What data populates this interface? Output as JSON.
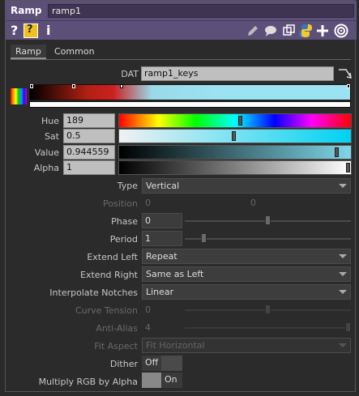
{
  "colors": {
    "titlebar": "#5c4f78",
    "accent": "#6a5a8e"
  },
  "titlebar": {
    "op_type": "Ramp",
    "op_name": "ramp1"
  },
  "iconbar": {
    "left_icons": [
      "help-icon",
      "python-help-icon",
      "info-icon"
    ],
    "right_icons": [
      "pencil-icon",
      "comment-icon",
      "clone-icon",
      "python-icon",
      "add-icon",
      "target-icon"
    ]
  },
  "tabs": [
    {
      "label": "Ramp",
      "active": true
    },
    {
      "label": "Common",
      "active": false
    }
  ],
  "params": {
    "dat": {
      "label": "DAT",
      "value": "ramp1_keys"
    },
    "hue": {
      "label": "Hue",
      "value": "189",
      "fraction": 0.52
    },
    "sat": {
      "label": "Sat",
      "value": "0.5",
      "fraction": 0.5
    },
    "value": {
      "label": "Value",
      "value": "0.944559",
      "fraction": 0.94
    },
    "alpha": {
      "label": "Alpha",
      "value": "1",
      "fraction": 1.0
    },
    "type": {
      "label": "Type",
      "value": "Vertical"
    },
    "position": {
      "label": "Position",
      "value1": "0",
      "value2": "0"
    },
    "phase": {
      "label": "Phase",
      "value": "0",
      "fraction": 0.5
    },
    "period": {
      "label": "Period",
      "value": "1",
      "fraction": 0.12
    },
    "extend_left": {
      "label": "Extend Left",
      "value": "Repeat"
    },
    "extend_right": {
      "label": "Extend Right",
      "value": "Same as Left"
    },
    "interpolate": {
      "label": "Interpolate Notches",
      "value": "Linear"
    },
    "curve_tension": {
      "label": "Curve Tension",
      "value": "0",
      "fraction": 0.5
    },
    "anti_alias": {
      "label": "Anti-Alias",
      "value": "4",
      "fraction": 1.0
    },
    "fit_aspect": {
      "label": "Fit Aspect",
      "value": "Fit Horizontal"
    },
    "dither": {
      "label": "Dither",
      "state": "Off"
    },
    "multiply": {
      "label": "Multiply RGB by Alpha",
      "state": "On"
    }
  }
}
